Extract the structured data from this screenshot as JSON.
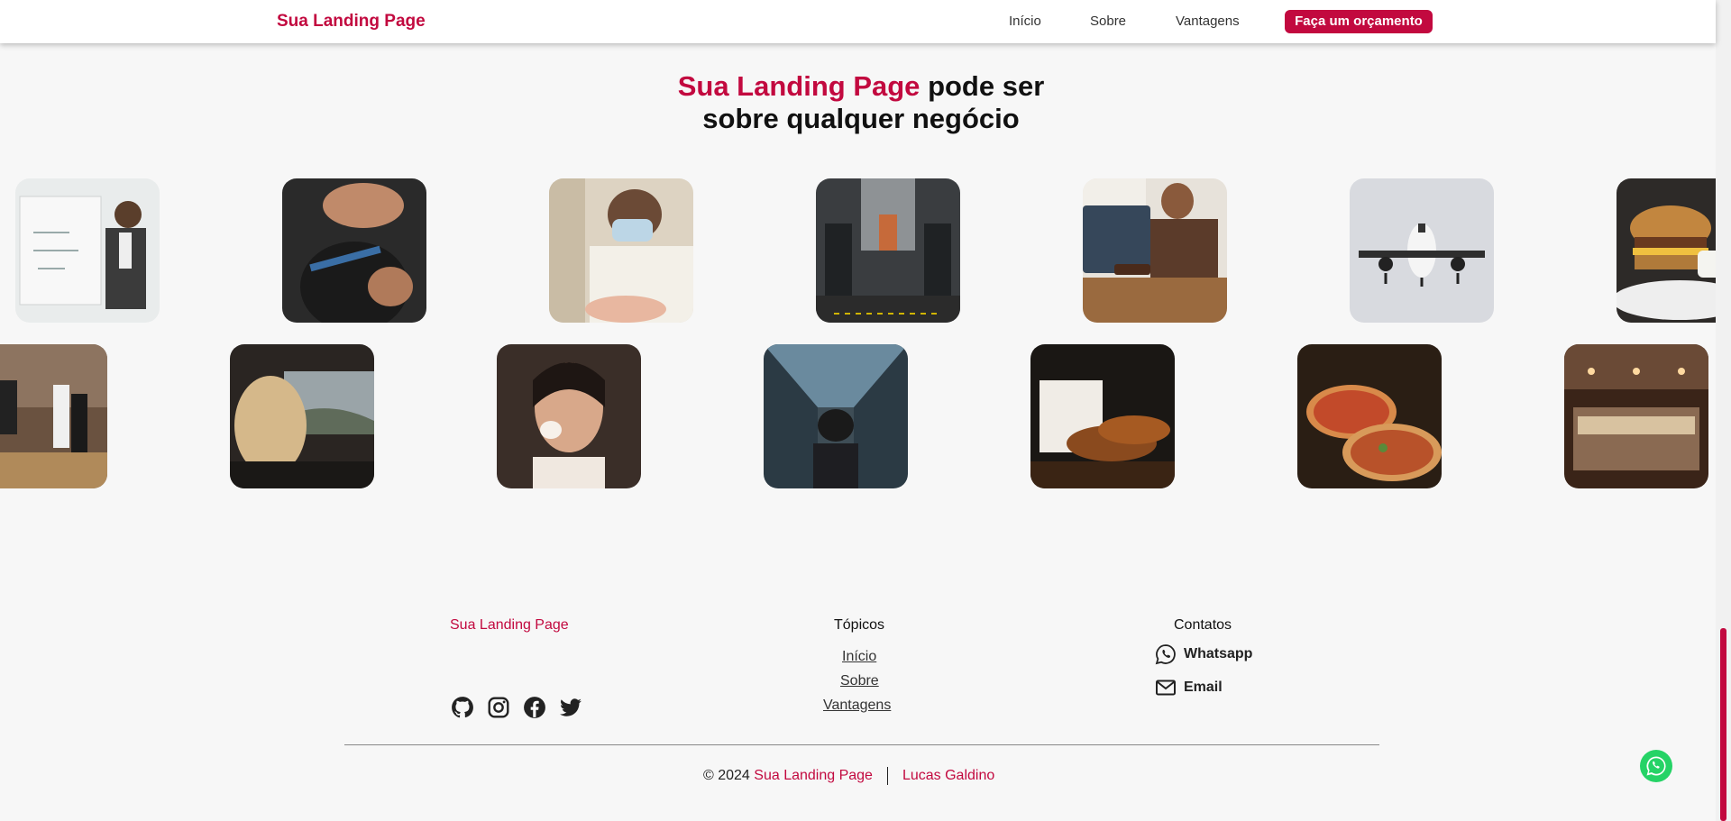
{
  "header": {
    "brand": "Sua Landing Page",
    "nav": [
      "Início",
      "Sobre",
      "Vantagens"
    ],
    "cta": "Faça um orçamento"
  },
  "section": {
    "title_accent": "Sua Landing Page",
    "title_rest": "pode ser",
    "title_line2": "sobre qualquer negócio"
  },
  "gallery": {
    "row1": [
      "whiteboard-presenter",
      "barber",
      "dentist",
      "gym",
      "lawyer",
      "airplane",
      "burger"
    ],
    "row2": [
      "musicians",
      "car-driver",
      "makeup",
      "escalator-dancer",
      "shoes-clothes",
      "pizza",
      "bakery-store"
    ]
  },
  "footer": {
    "brand": "Sua Landing Page",
    "topics_title": "Tópicos",
    "topics": [
      "Início",
      "Sobre",
      "Vantagens"
    ],
    "contacts_title": "Contatos",
    "contacts": [
      "Whatsapp",
      "Email"
    ],
    "socials": [
      "github-icon",
      "instagram-icon",
      "facebook-icon",
      "twitter-icon"
    ],
    "copyright_prefix": "© 2024",
    "copyright_brand": "Sua Landing Page",
    "author": "Lucas Galdino"
  },
  "colors": {
    "accent": "#c2093f",
    "background": "#f7f7f7",
    "whatsapp": "#25d366"
  }
}
